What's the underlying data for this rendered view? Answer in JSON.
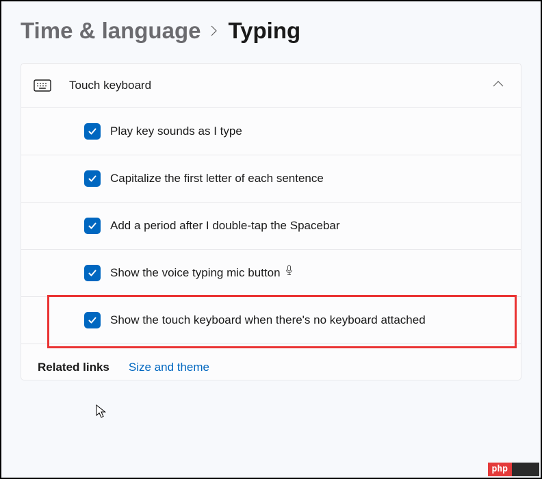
{
  "breadcrumb": {
    "parent": "Time & language",
    "current": "Typing"
  },
  "panel": {
    "title": "Touch keyboard"
  },
  "options": [
    {
      "label": "Play key sounds as I type",
      "checked": true
    },
    {
      "label": "Capitalize the first letter of each sentence",
      "checked": true
    },
    {
      "label": "Add a period after I double-tap the Spacebar",
      "checked": true
    },
    {
      "label": "Show the voice typing mic button",
      "checked": true,
      "trailing_icon": "mic"
    },
    {
      "label": "Show the touch keyboard when there's no keyboard attached",
      "checked": true,
      "highlighted": true
    }
  ],
  "related": {
    "label": "Related links",
    "link": "Size and theme"
  },
  "watermark": {
    "left": "php"
  }
}
